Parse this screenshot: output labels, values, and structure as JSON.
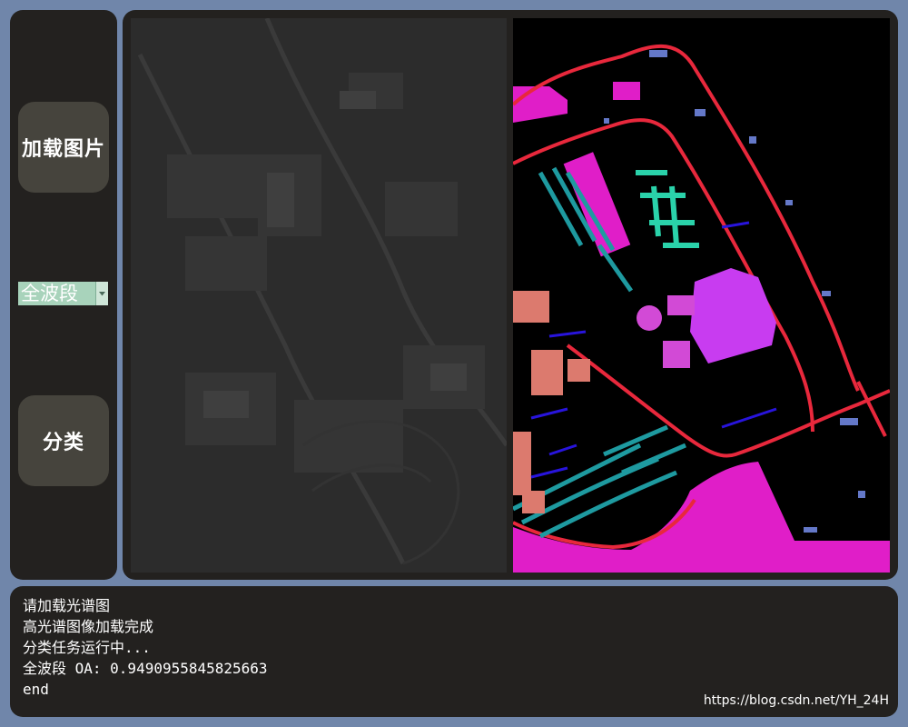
{
  "sidebar": {
    "load_button_label": "加载图片",
    "band_select": {
      "selected": "全波段"
    },
    "classify_button_label": "分类"
  },
  "viewer": {
    "left_image": "hyperspectral-grayscale-image",
    "right_image": "classification-result-map"
  },
  "console": {
    "lines": [
      "请加载光谱图",
      "高光谱图像加载完成",
      "分类任务运行中...",
      "全波段 OA: 0.9490955845825663",
      "end"
    ]
  },
  "watermark": "https://blog.csdn.net/YH_24H",
  "colors": {
    "background": "#7086aa",
    "panel": "#23211f",
    "button": "#46443d",
    "combo": "#a8d3bb",
    "class_magenta": "#e01ec8",
    "class_red": "#e8283c",
    "class_teal": "#1e9aa0",
    "class_green": "#2ad2aa",
    "class_violet": "#c83cf0",
    "class_blue": "#2814dc",
    "class_periwinkle": "#6478c8",
    "class_salmon": "#dc7a6e"
  }
}
